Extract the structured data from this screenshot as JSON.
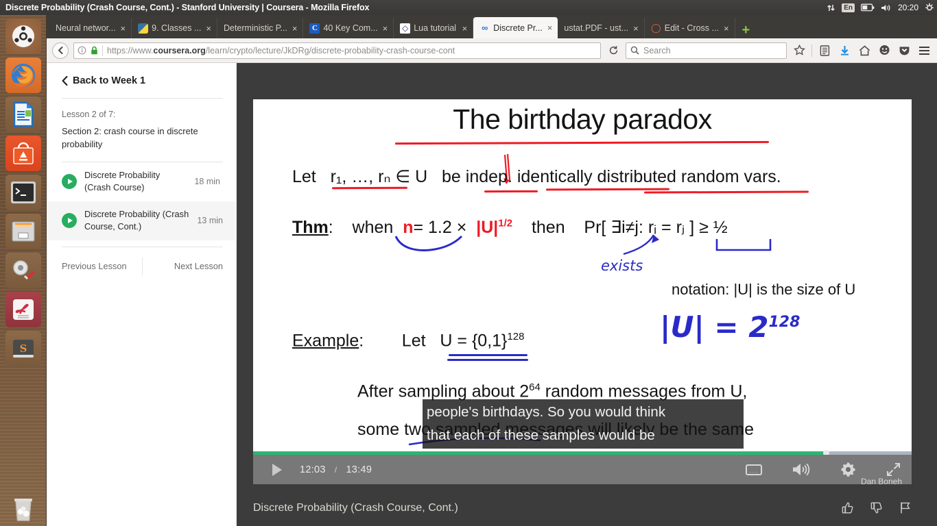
{
  "window": {
    "title": "Discrete Probability (Crash Course, Cont.) - Stanford University | Coursera - Mozilla Firefox"
  },
  "tray": {
    "network_icon": "network-updown-icon",
    "keyboard_layout": "En",
    "battery_icon": "battery-icon",
    "volume_icon": "volume-icon",
    "clock": "20:20",
    "power_icon": "power-gear-icon"
  },
  "launcher": {
    "items": [
      {
        "name": "ubuntu-dash",
        "icon": "ubuntu-logo-icon",
        "running": false,
        "focused": false
      },
      {
        "name": "firefox",
        "icon": "firefox-icon",
        "running": true,
        "focused": true
      },
      {
        "name": "libreoffice-writer",
        "icon": "document-icon",
        "running": false,
        "focused": false
      },
      {
        "name": "ubuntu-software",
        "icon": "software-bag-icon",
        "running": false,
        "focused": false
      },
      {
        "name": "terminal",
        "icon": "terminal-icon",
        "running": false,
        "focused": true
      },
      {
        "name": "file-manager",
        "icon": "file-cabinet-icon",
        "running": true,
        "focused": false
      },
      {
        "name": "system-settings",
        "icon": "gear-wrench-icon",
        "running": false,
        "focused": false
      },
      {
        "name": "pdf-reader",
        "icon": "pdf-document-icon",
        "running": true,
        "focused": false
      },
      {
        "name": "sublime-text",
        "icon": "sublime-s-icon",
        "running": false,
        "focused": false
      }
    ],
    "trash": {
      "name": "trash",
      "icon": "trash-bin-icon"
    }
  },
  "browser": {
    "tabs": [
      {
        "label": "Neural networ...",
        "favicon": "none",
        "active": false
      },
      {
        "label": "9. Classes ...",
        "favicon": "python-icon",
        "active": false
      },
      {
        "label": "Deterministic P...",
        "favicon": "none",
        "active": false
      },
      {
        "label": "40 Key Com...",
        "favicon": "c-letter-icon",
        "active": false
      },
      {
        "label": "Lua tutorial",
        "favicon": "lua-moon-icon",
        "active": false
      },
      {
        "label": "Discrete Pr...",
        "favicon": "coursera-icon",
        "active": true
      },
      {
        "label": "ustat.PDF - ust...",
        "favicon": "none",
        "active": false
      },
      {
        "label": "Edit - Cross ...",
        "favicon": "edit-ring-icon",
        "active": false
      }
    ],
    "close_glyph": "×",
    "new_tab_glyph": "+",
    "nav": {
      "back_icon": "back-arrow-icon",
      "info_icon": "page-info-icon",
      "lock_icon": "padlock-icon",
      "url_prefix": "https://www.",
      "url_domain": "coursera.org",
      "url_path": "/learn/crypto/lecture/JkDRg/discrete-probability-crash-course-cont",
      "reload_icon": "reload-icon",
      "search_icon": "search-icon",
      "search_placeholder": "Search",
      "bookmark_icon": "star-icon",
      "library_icon": "library-icon",
      "downloads_icon": "download-arrow-icon",
      "home_icon": "home-icon",
      "sync_icon": "smiley-icon",
      "pocket_icon": "pocket-shield-icon",
      "menu_icon": "hamburger-menu-icon"
    }
  },
  "sidebar": {
    "back_label": "Back to Week 1",
    "back_chevron": "‹",
    "lesson_counter": "Lesson 2 of 7:",
    "section_title": "Section 2: crash course in discrete probability",
    "lectures": [
      {
        "title": "Discrete Probability (Crash Course)",
        "duration": "18 min",
        "current": false
      },
      {
        "title": "Discrete Probability (Crash Course, Cont.)",
        "duration": "13 min",
        "current": true
      }
    ],
    "previous_lesson": "Previous Lesson",
    "next_lesson": "Next Lesson"
  },
  "slide": {
    "title": "The birthday paradox",
    "line_let": "Let",
    "line_vars": "r₁, …, rₙ ∈ U",
    "line_indep": "be indep. identically distributed random vars.",
    "thm_label": "Thm",
    "thm_colon": ":",
    "thm_when": "when",
    "thm_n": "n",
    "thm_eq": "= 1.2 ×",
    "thm_u": "|U|",
    "thm_exp": "1/2",
    "thm_then": "then",
    "thm_pr": "Pr[ ∃i≠j:  rᵢ = rⱼ ] ≥ ½",
    "ink_exists": "exists",
    "notation": "notation:  |U| is the size of U",
    "example_label": "Example",
    "example_colon": ":",
    "example_let": "Let",
    "example_u": "U = {0,1}",
    "example_exp": "128",
    "ink_size": "|U| = 2",
    "ink_size_exp": "128",
    "body_line1_a": "After sampling about  2",
    "body_line1_exp": "64",
    "body_line1_b": "  random messages from U,",
    "body_line2": "some two sampled messages will likely be the same"
  },
  "subtitle": {
    "line1": "people's birthdays. So you would think",
    "line2": "that each of these samples would be"
  },
  "player": {
    "play_icon": "play-icon",
    "current_time": "12:03",
    "separator": "/",
    "total_time": "13:49",
    "progress_percent": 87,
    "cc_icon": "closed-captions-icon",
    "cc_label": "....",
    "volume_icon": "volume-icon",
    "settings_icon": "gear-icon",
    "fullscreen_icon": "fullscreen-icon",
    "watermark": "Dan Boneh"
  },
  "video_header": {
    "title": "Discrete Probability (Crash Course, Cont.)",
    "like_icon": "thumbs-up-icon",
    "dislike_icon": "thumbs-down-icon",
    "flag_icon": "flag-icon"
  },
  "colors": {
    "coursera_blue": "#2a73cc",
    "progress_green": "#2bb673",
    "accent_red": "#ee1b24",
    "ink_blue": "#2a2aca",
    "play_green": "#27ad60"
  }
}
